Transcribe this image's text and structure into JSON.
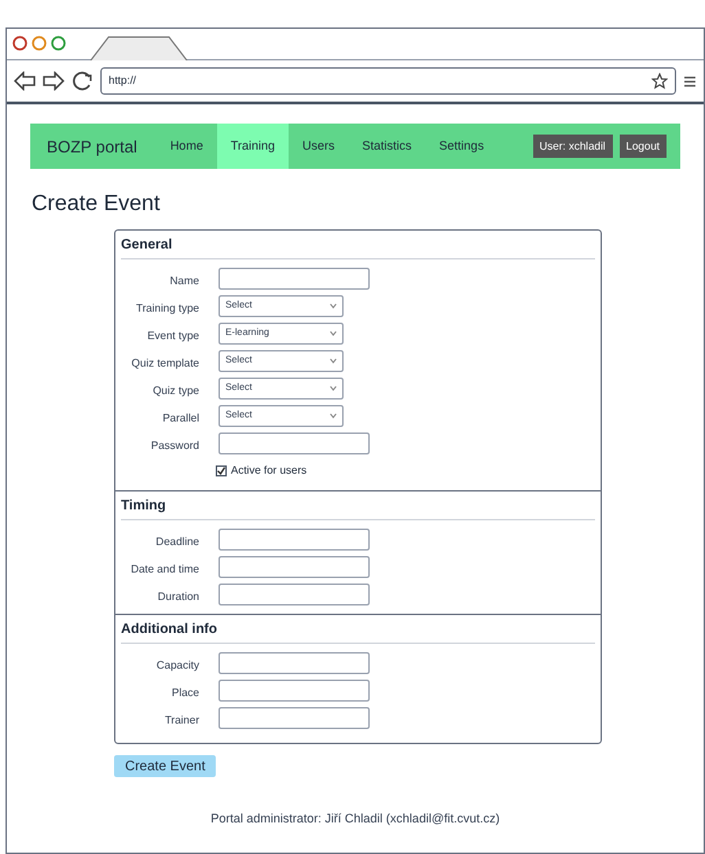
{
  "browser": {
    "url": "http://"
  },
  "nav": {
    "brand": "BOZP portal",
    "items": [
      {
        "label": "Home",
        "selected": false
      },
      {
        "label": "Training",
        "selected": true
      },
      {
        "label": "Users",
        "selected": false
      },
      {
        "label": "Statistics",
        "selected": false
      },
      {
        "label": "Settings",
        "selected": false
      }
    ],
    "user_button": "User: xchladil",
    "logout_button": "Logout"
  },
  "title": "Create Event",
  "sections": [
    {
      "heading": "General",
      "fields": [
        {
          "kind": "text",
          "label": "Name"
        },
        {
          "kind": "select",
          "label": "Training type",
          "value": "Select"
        },
        {
          "kind": "select",
          "label": "Event type",
          "value": "E-learning"
        },
        {
          "kind": "select",
          "label": "Quiz template",
          "value": "Select"
        },
        {
          "kind": "select",
          "label": "Quiz type",
          "value": "Select"
        },
        {
          "kind": "select",
          "label": "Parallel",
          "value": "Select"
        },
        {
          "kind": "text",
          "label": "Password"
        },
        {
          "kind": "checkbox",
          "label": "Active for users",
          "checked": true
        }
      ]
    },
    {
      "heading": "Timing",
      "fields": [
        {
          "kind": "text",
          "label": "Deadline"
        },
        {
          "kind": "text",
          "label": "Date and time"
        },
        {
          "kind": "text",
          "label": "Duration"
        }
      ]
    },
    {
      "heading": "Additional info",
      "fields": [
        {
          "kind": "text",
          "label": "Capacity"
        },
        {
          "kind": "text",
          "label": "Place"
        },
        {
          "kind": "text",
          "label": "Trainer"
        }
      ]
    }
  ],
  "submit_button": "Create Event",
  "footer": "Portal administrator: Jiří Chladil (xchladil@fit.cvut.cz)"
}
